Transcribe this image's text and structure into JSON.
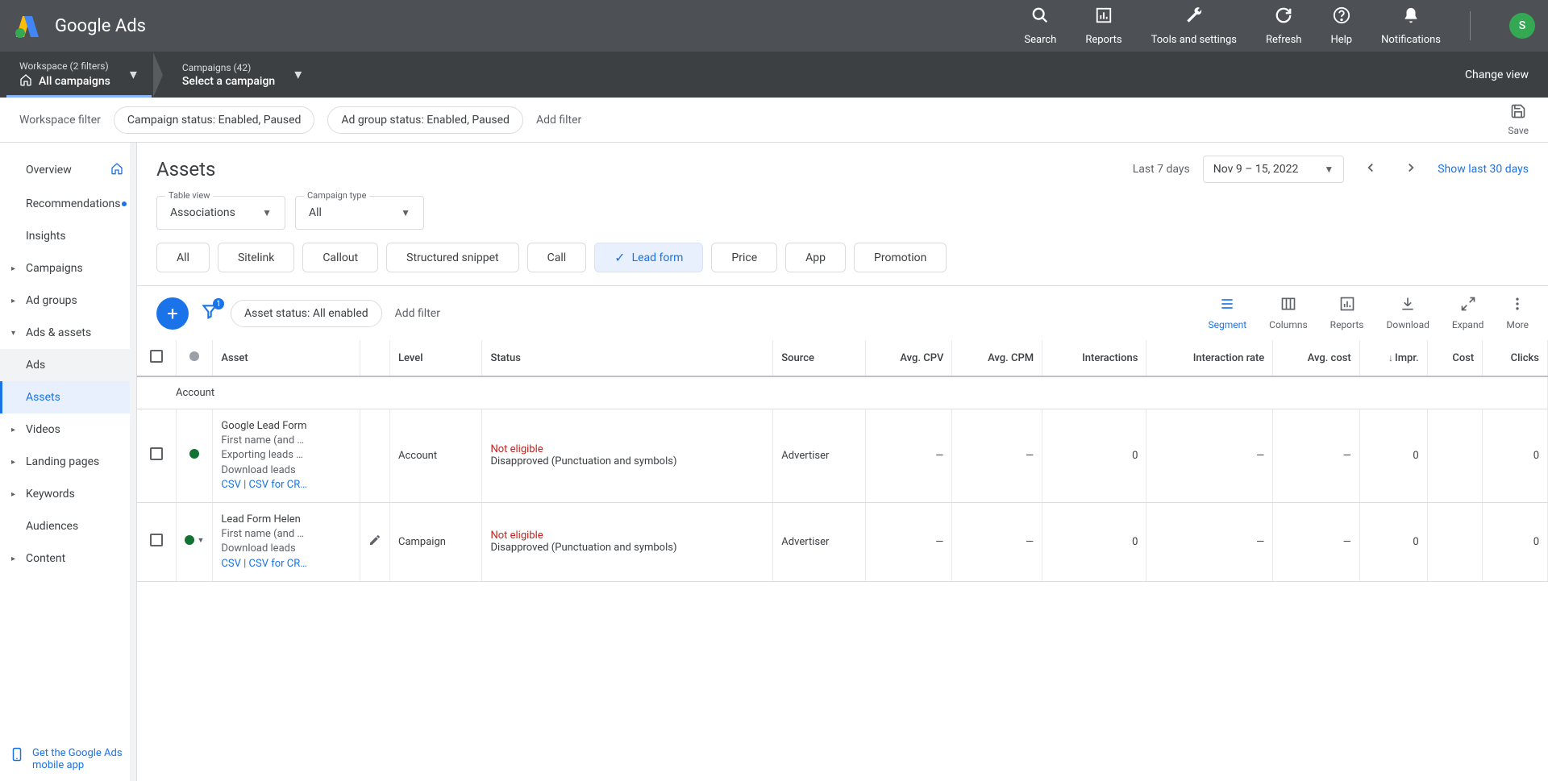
{
  "logo_text": "Google Ads",
  "top_actions": {
    "search": "Search",
    "reports": "Reports",
    "tools": "Tools and settings",
    "refresh": "Refresh",
    "help": "Help",
    "notifications": "Notifications"
  },
  "avatar_initial": "S",
  "breadcrumb": {
    "workspace_label": "Workspace (2 filters)",
    "workspace_value": "All campaigns",
    "campaigns_label": "Campaigns (42)",
    "campaigns_value": "Select a campaign",
    "change_view": "Change view"
  },
  "filter_bar": {
    "label": "Workspace filter",
    "chip1": "Campaign status: Enabled, Paused",
    "chip2": "Ad group status: Enabled, Paused",
    "add": "Add filter",
    "save": "Save"
  },
  "sidebar": {
    "overview": "Overview",
    "recommendations": "Recommendations",
    "insights": "Insights",
    "campaigns": "Campaigns",
    "ad_groups": "Ad groups",
    "ads_assets": "Ads & assets",
    "ads": "Ads",
    "assets": "Assets",
    "videos": "Videos",
    "landing_pages": "Landing pages",
    "keywords": "Keywords",
    "audiences": "Audiences",
    "content": "Content",
    "mobile_app": "Get the Google Ads mobile app"
  },
  "page": {
    "title": "Assets",
    "date_hint": "Last 7 days",
    "date_range": "Nov 9 – 15, 2022",
    "show_30": "Show last 30 days"
  },
  "selects": {
    "table_view_legend": "Table view",
    "table_view_value": "Associations",
    "campaign_type_legend": "Campaign type",
    "campaign_type_value": "All"
  },
  "asset_types": {
    "all": "All",
    "sitelink": "Sitelink",
    "callout": "Callout",
    "structured": "Structured snippet",
    "call": "Call",
    "lead_form": "Lead form",
    "price": "Price",
    "app": "App",
    "promotion": "Promotion"
  },
  "table_toolbar": {
    "status_chip": "Asset status: All enabled",
    "add_filter": "Add filter",
    "filter_badge": "1",
    "segment": "Segment",
    "columns": "Columns",
    "reports": "Reports",
    "download": "Download",
    "expand": "Expand",
    "more": "More"
  },
  "columns": {
    "asset": "Asset",
    "level": "Level",
    "status": "Status",
    "source": "Source",
    "avg_cpv": "Avg. CPV",
    "avg_cpm": "Avg. CPM",
    "interactions": "Interactions",
    "interaction_rate": "Interaction rate",
    "avg_cost": "Avg. cost",
    "impr": "Impr.",
    "cost": "Cost",
    "clicks": "Clicks"
  },
  "subhead": "Account",
  "rows": [
    {
      "name": "Google Lead Form",
      "desc": "First name (and …",
      "hint": "Exporting leads …",
      "download": "Download leads",
      "csv": "CSV",
      "csv_crm": "CSV for CR…",
      "level": "Account",
      "status_main": "Not eligible",
      "status_sub": "Disapproved (Punctuation and symbols)",
      "source": "Advertiser",
      "avg_cpv": "—",
      "avg_cpm": "—",
      "interactions": "0",
      "interaction_rate": "—",
      "avg_cost": "—",
      "impr": "0",
      "cost": "",
      "clicks": "0",
      "show_edit": false
    },
    {
      "name": "Lead Form Helen",
      "desc": "First name (and …",
      "hint": "",
      "download": "Download leads",
      "csv": "CSV",
      "csv_crm": "CSV for CR…",
      "level": "Campaign",
      "status_main": "Not eligible",
      "status_sub": "Disapproved (Punctuation and symbols)",
      "source": "Advertiser",
      "avg_cpv": "—",
      "avg_cpm": "—",
      "interactions": "0",
      "interaction_rate": "—",
      "avg_cost": "—",
      "impr": "0",
      "cost": "",
      "clicks": "0",
      "show_edit": true
    }
  ]
}
